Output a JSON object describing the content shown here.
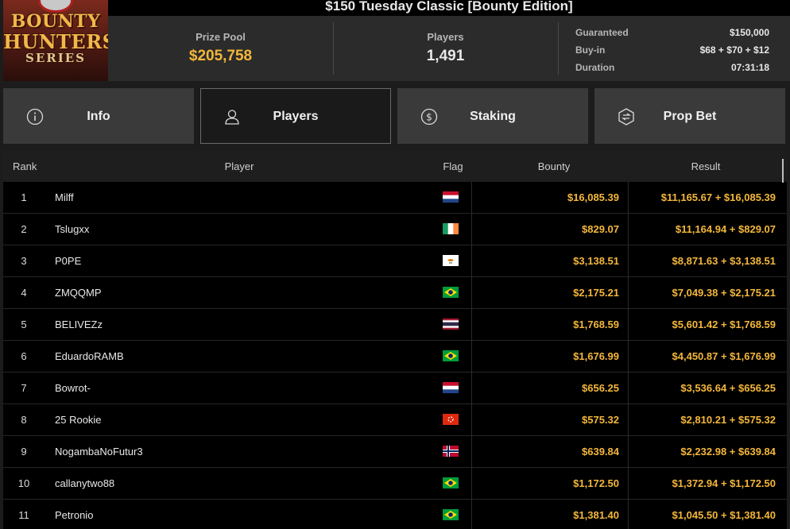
{
  "logo": {
    "line1": "BOUNTY",
    "line2": "HUNTERS",
    "line3": "SERIES"
  },
  "title": "$150 Tuesday Classic [Bounty Edition]",
  "prize_pool": {
    "label": "Prize Pool",
    "value": "$205,758"
  },
  "players_stat": {
    "label": "Players",
    "value": "1,491"
  },
  "details": [
    {
      "label": "Guaranteed",
      "value": "$150,000"
    },
    {
      "label": "Buy-in",
      "value": "$68 + $70 + $12"
    },
    {
      "label": "Duration",
      "value": "07:31:18"
    }
  ],
  "tabs": [
    {
      "label": "Info",
      "icon": "info-icon",
      "active": false
    },
    {
      "label": "Players",
      "icon": "user-icon",
      "active": true
    },
    {
      "label": "Staking",
      "icon": "dollar-coin-icon",
      "active": false
    },
    {
      "label": "Prop Bet",
      "icon": "prop-bet-icon",
      "active": false
    }
  ],
  "table": {
    "headers": {
      "rank": "Rank",
      "player": "Player",
      "flag": "Flag",
      "bounty": "Bounty",
      "result": "Result"
    },
    "rows": [
      {
        "rank": "1",
        "player": "Milff",
        "flag": "netherlands",
        "bounty": "$16,085.39",
        "result": "$11,165.67 + $16,085.39"
      },
      {
        "rank": "2",
        "player": "Tslugxx",
        "flag": "ireland",
        "bounty": "$829.07",
        "result": "$11,164.94 + $829.07"
      },
      {
        "rank": "3",
        "player": "P0PE",
        "flag": "cyprus",
        "bounty": "$3,138.51",
        "result": "$8,871.63 + $3,138.51"
      },
      {
        "rank": "4",
        "player": "ZMQQMP",
        "flag": "brazil",
        "bounty": "$2,175.21",
        "result": "$7,049.38 + $2,175.21"
      },
      {
        "rank": "5",
        "player": "BELIVEZz",
        "flag": "thailand",
        "bounty": "$1,768.59",
        "result": "$5,601.42 + $1,768.59"
      },
      {
        "rank": "6",
        "player": "EduardoRAMB",
        "flag": "brazil",
        "bounty": "$1,676.99",
        "result": "$4,450.87 + $1,676.99"
      },
      {
        "rank": "7",
        "player": "Bowrot-",
        "flag": "netherlands",
        "bounty": "$656.25",
        "result": "$3,536.64 + $656.25"
      },
      {
        "rank": "8",
        "player": "25 Rookie",
        "flag": "hong-kong",
        "bounty": "$575.32",
        "result": "$2,810.21 + $575.32"
      },
      {
        "rank": "9",
        "player": "NogambaNoFutur3",
        "flag": "norway",
        "bounty": "$639.84",
        "result": "$2,232.98 + $639.84"
      },
      {
        "rank": "10",
        "player": "callanytwo88",
        "flag": "brazil",
        "bounty": "$1,172.50",
        "result": "$1,372.94 + $1,172.50"
      },
      {
        "rank": "11",
        "player": "Petronio",
        "flag": "brazil",
        "bounty": "$1,381.40",
        "result": "$1,045.50 + $1,381.40"
      }
    ]
  },
  "colors": {
    "accent_gold": "#f4b73a",
    "panel": "#2b2b2b",
    "tab": "#3a3a3a",
    "table_bg": "#000000"
  }
}
